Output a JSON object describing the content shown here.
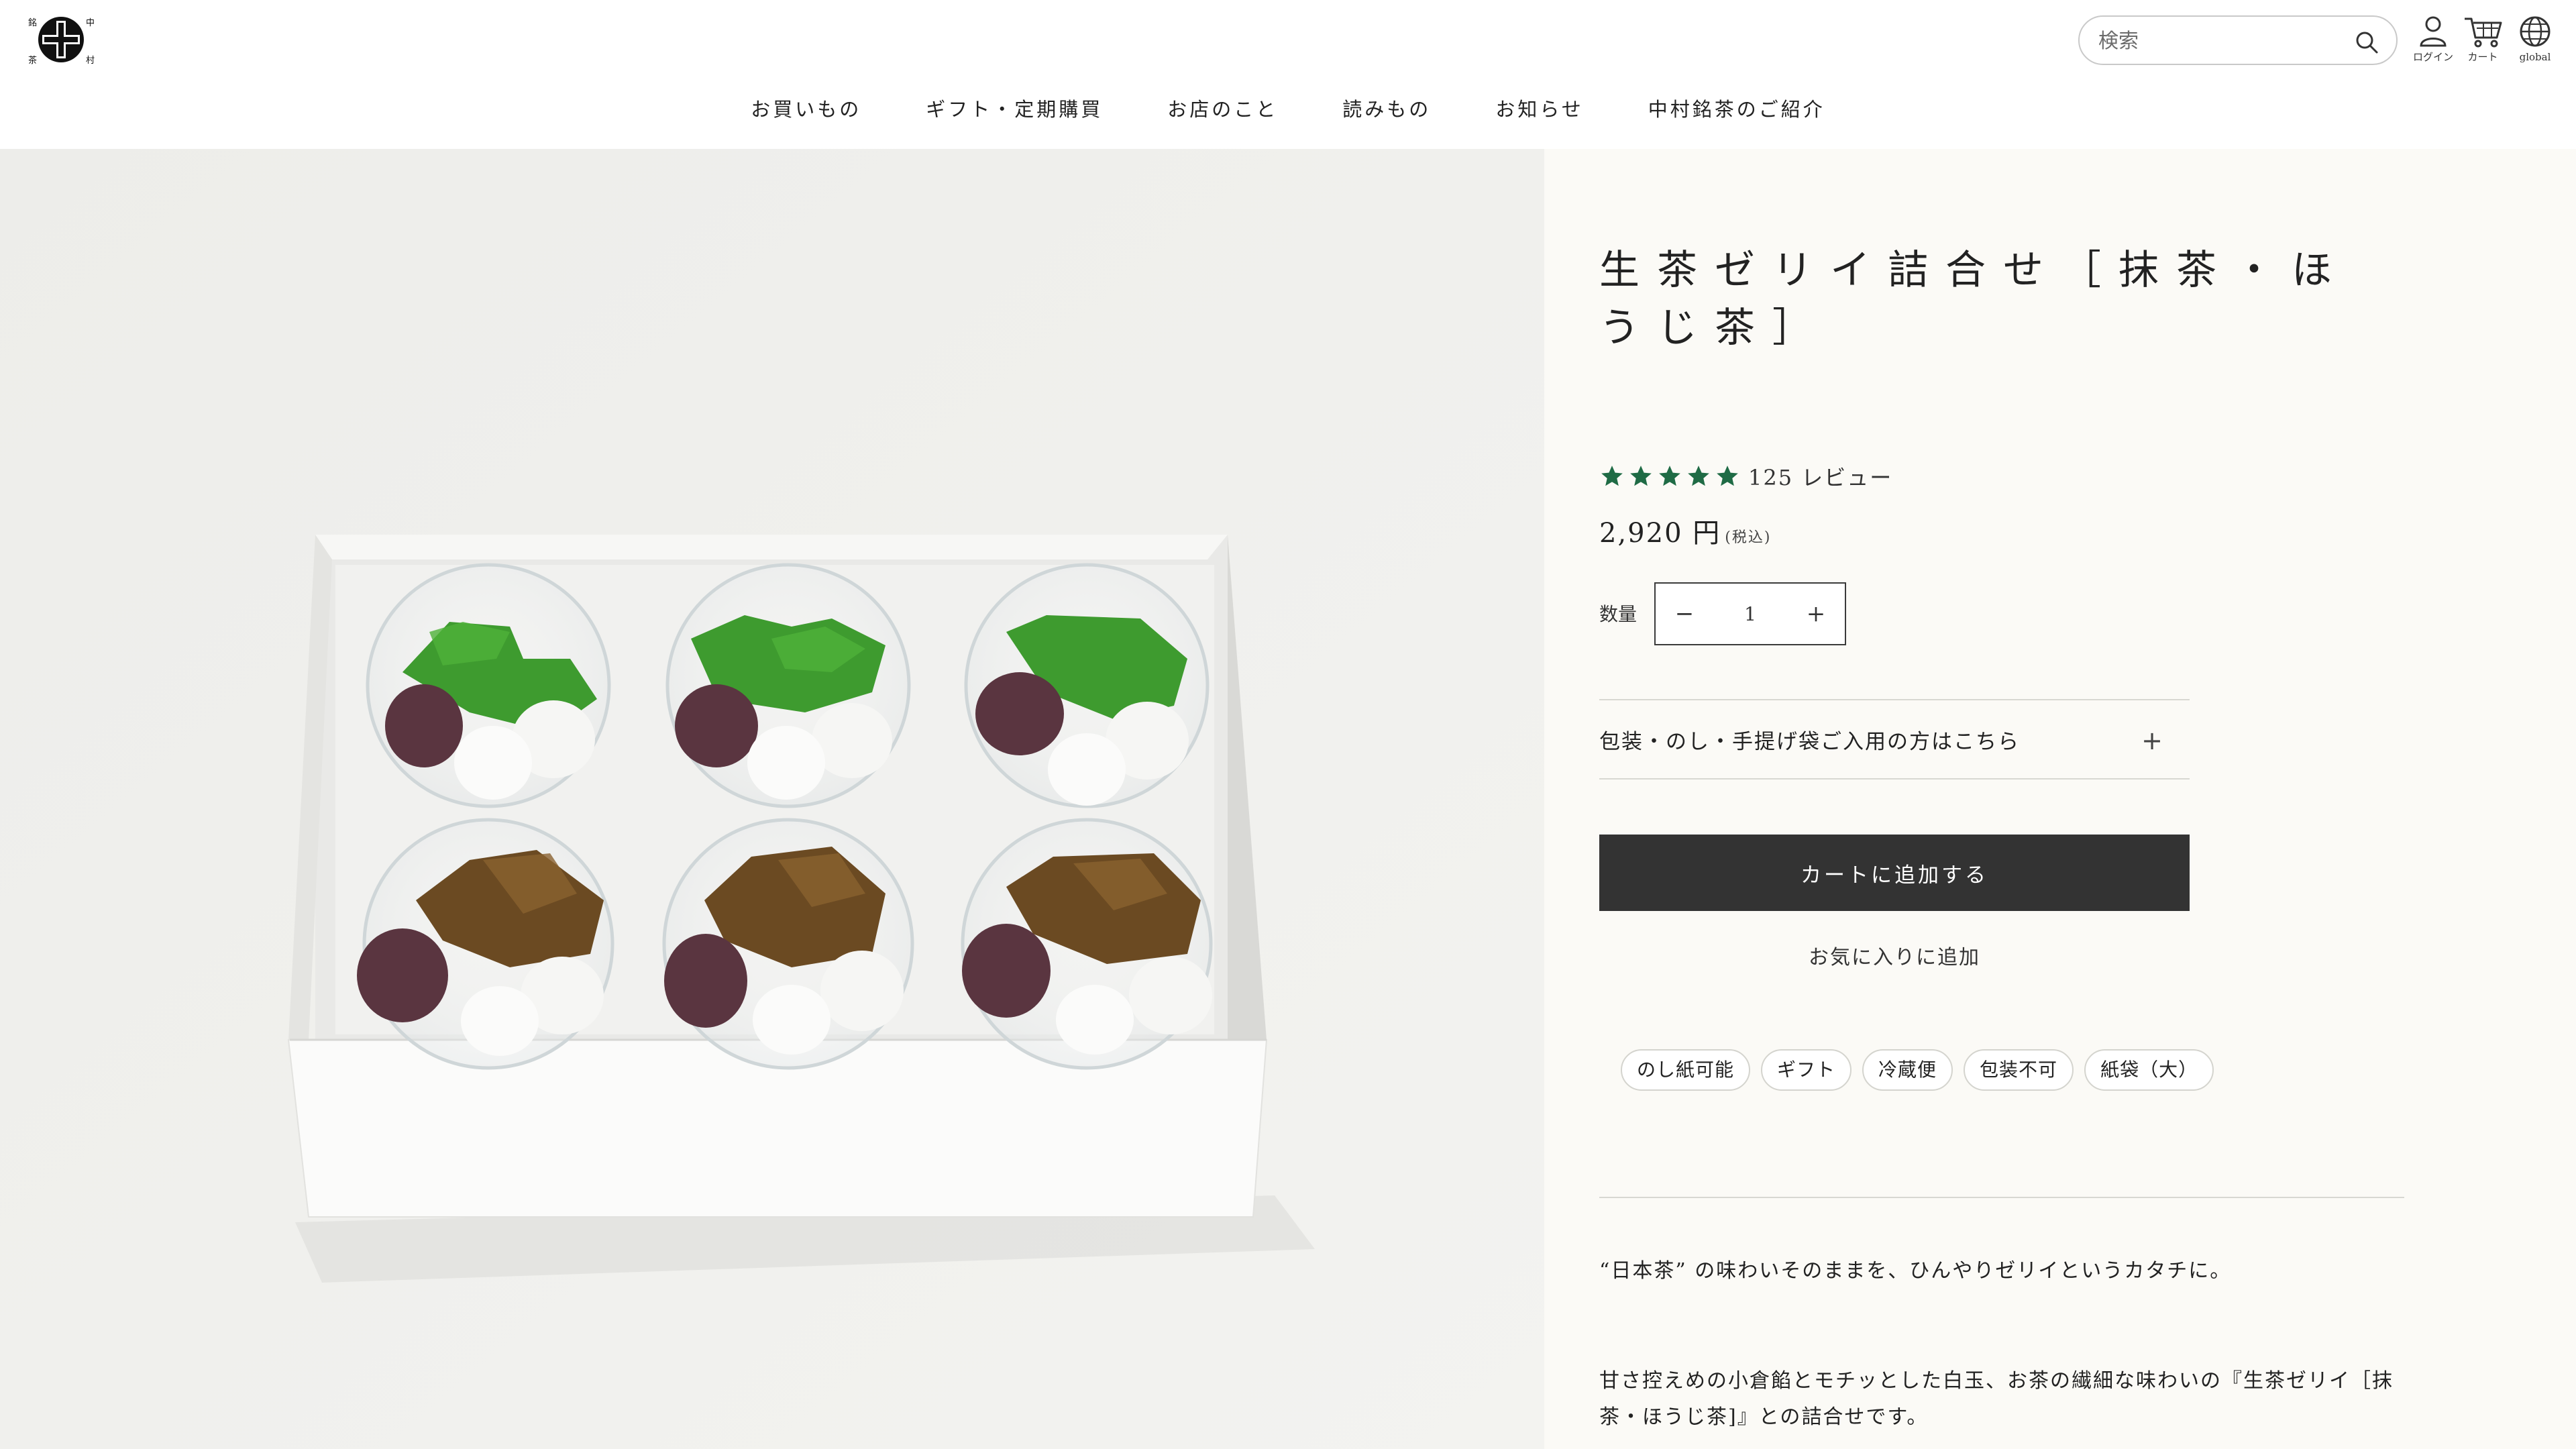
{
  "header": {
    "logo_chars": [
      "銘",
      "茶",
      "中",
      "村"
    ],
    "search_placeholder": "検索",
    "account_label": "ログイン",
    "cart_label": "カート",
    "global_label": "global"
  },
  "nav": {
    "items": [
      "お買いもの",
      "ギフト・定期購買",
      "お店のこと",
      "読みもの",
      "お知らせ",
      "中村銘茶のご紹介"
    ]
  },
  "product": {
    "title": "生茶ゼリイ詰合せ［抹茶・ほうじ茶］",
    "rating_stars": 5,
    "review_count": "125 レビュー",
    "price": "2,920 円",
    "tax_note": "(税込)",
    "quantity_label": "数量",
    "quantity_value": "1",
    "minus_symbol": "−",
    "plus_symbol": "+",
    "wrapping_label": "包装・のし・手提げ袋ご入用の方はこちら",
    "add_to_cart": "カートに追加する",
    "add_to_favorites": "お気に入りに追加",
    "tags": [
      "のし紙可能",
      "ギフト",
      "冷蔵便",
      "包装不可",
      "紙袋（大）"
    ],
    "description_1": "“日本茶” の味わいそのままを、ひんやりゼリイというカタチに。",
    "description_2": "甘さ控えめの小倉餡とモチッとした白玉、お茶の繊細な味わいの『生茶ゼリイ［抹茶・ほうじ茶]』との詰合せです。"
  },
  "colors": {
    "star": "#1f6b45",
    "button_dark": "#333333",
    "panel_bg": "#fbfaf6",
    "image_bg": "#eeeeea",
    "matcha": "#3e9b2f",
    "hojicha": "#6b4a22",
    "anko": "#5a3540"
  }
}
